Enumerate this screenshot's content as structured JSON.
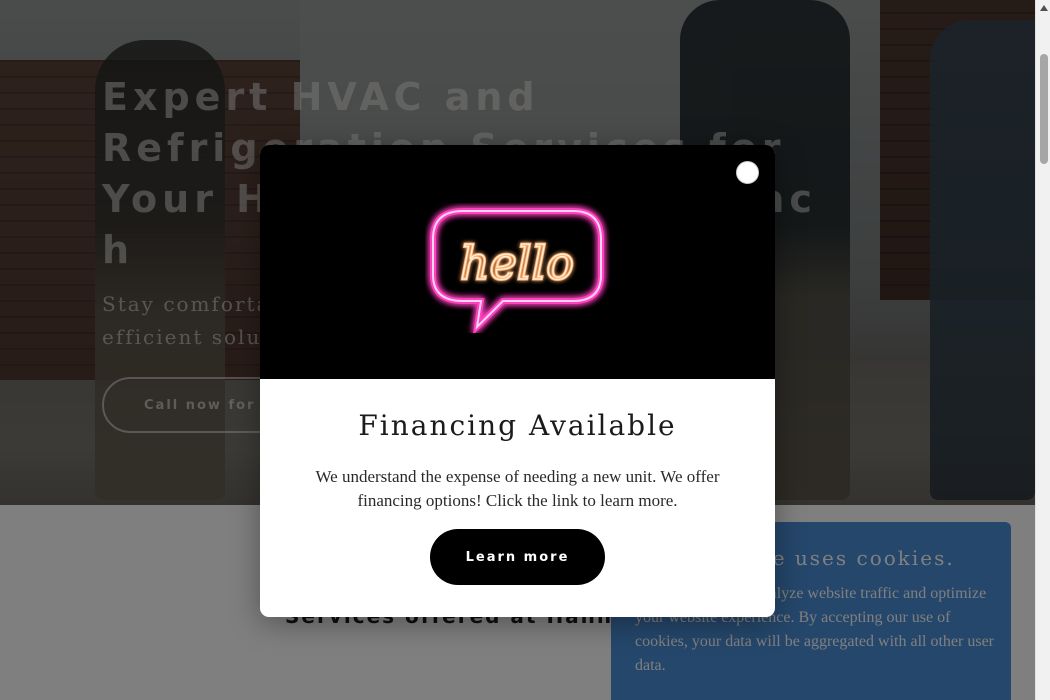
{
  "hero": {
    "title": "Expert HVAC and Refrigeration Services for Your Home and Business ac h",
    "subtitle": "Stay comfortable year-round with reliable, efficient solutions",
    "cta_label": "Call now for a quote"
  },
  "services": {
    "heading": "Services offered at Hannah's Refrigeration"
  },
  "modal": {
    "image_label": "hello",
    "title": "Financing Available",
    "text": "We understand the expense of needing a new unit. We offer financing options! Click the link to learn more.",
    "button_label": "Learn more",
    "close_icon": "close-icon"
  },
  "cookie": {
    "title": "This website uses cookies.",
    "text": "We use cookies to analyze website traffic and optimize your website experience. By accepting our use of cookies, your data will be aggregated with all other user data."
  },
  "colors": {
    "cookie_bg": "#4a8fd6",
    "modal_button": "#000000",
    "neon_pink": "#ff3fbf"
  }
}
